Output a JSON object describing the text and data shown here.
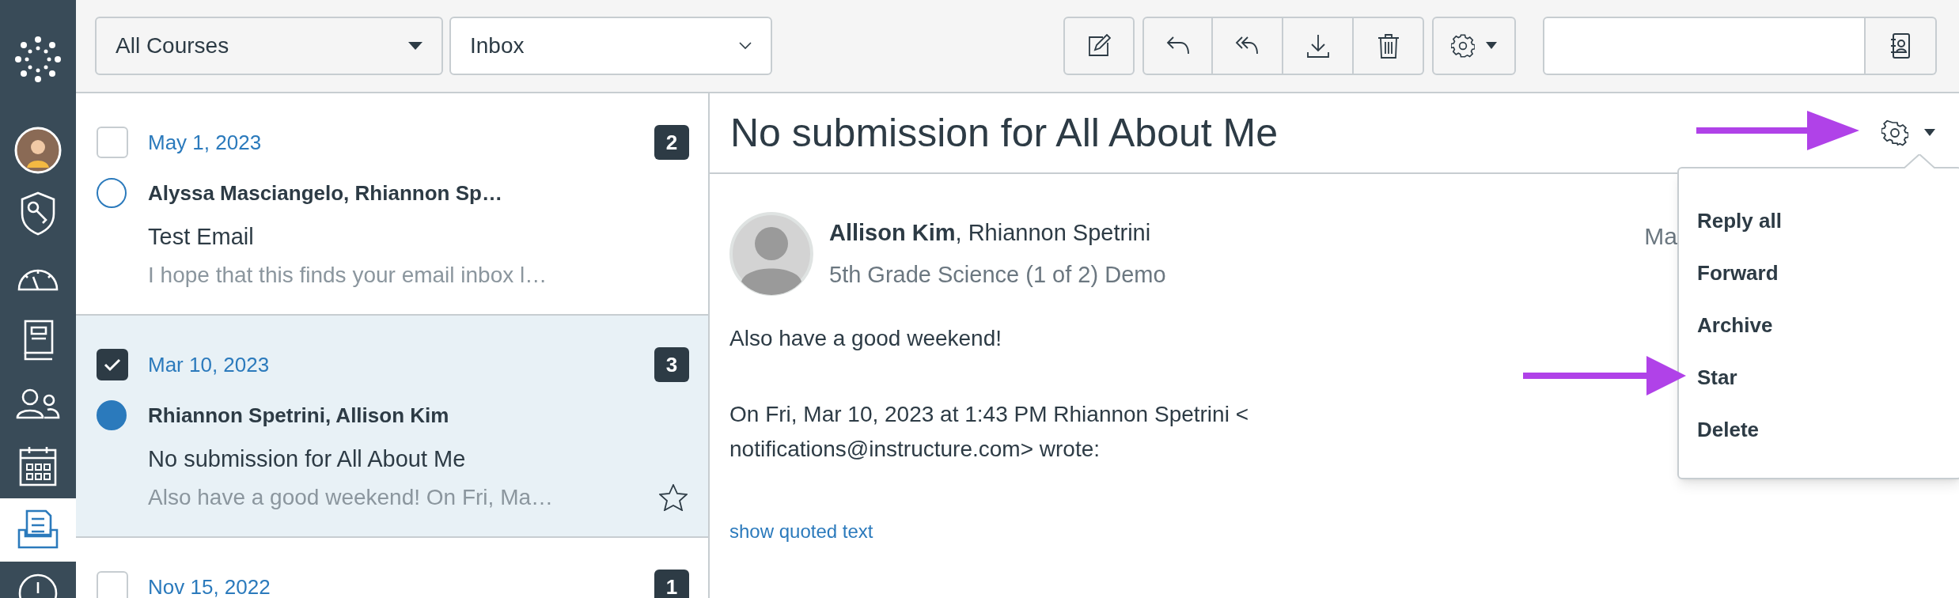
{
  "nav": {
    "items": [
      {
        "kind": "logo",
        "selected": false
      },
      {
        "kind": "account",
        "selected": false
      },
      {
        "kind": "admin",
        "selected": false
      },
      {
        "kind": "dashboard",
        "selected": false
      },
      {
        "kind": "courses",
        "selected": false
      },
      {
        "kind": "groups",
        "selected": false
      },
      {
        "kind": "calendar",
        "selected": false
      },
      {
        "kind": "inbox",
        "selected": true
      },
      {
        "kind": "history",
        "selected": false
      }
    ]
  },
  "toolbar": {
    "course_filter": "All Courses",
    "mailbox_filter": "Inbox",
    "buttons": [
      {
        "kind": "compose"
      },
      {
        "kind": "reply"
      },
      {
        "kind": "reply_all"
      },
      {
        "kind": "archive"
      },
      {
        "kind": "delete"
      },
      {
        "kind": "settings"
      }
    ]
  },
  "conversations": [
    {
      "date": "May 1, 2023",
      "count": "2",
      "checked": false,
      "selected": false,
      "unread": false,
      "participants": "Alyssa Masciangelo, Rhiannon Sp…",
      "subject": "Test Email",
      "preview": "I hope that this finds your email inbox l…"
    },
    {
      "date": "Mar 10, 2023",
      "count": "3",
      "checked": true,
      "selected": true,
      "unread": true,
      "participants": "Rhiannon Spetrini, Allison Kim",
      "subject": "No submission for All About Me",
      "preview": "Also have a good weekend! On Fri, Ma…"
    },
    {
      "date": "Nov 15, 2022",
      "count": "1",
      "checked": false,
      "selected": false
    }
  ],
  "message": {
    "title": "No submission for All About Me",
    "sender": "**Allison Kim**, Rhiannon Spetrini",
    "course": "5th Grade Science (1 of 2) Demo",
    "date": "Ma",
    "body": [
      {
        "kind": "text",
        "text": "Also have a good weekend!"
      },
      {
        "kind": "gap"
      },
      {
        "kind": "text",
        "text": "On Fri, Mar 10, 2023 at 1:43 PM Rhiannon Spetrini <"
      },
      {
        "kind": "text",
        "text": "notifications@instructure.com> wrote:"
      }
    ],
    "quoted_link": "show quoted text"
  },
  "actions_menu": {
    "items": [
      "Reply all",
      "Forward",
      "Archive",
      "Star",
      "Delete"
    ]
  }
}
